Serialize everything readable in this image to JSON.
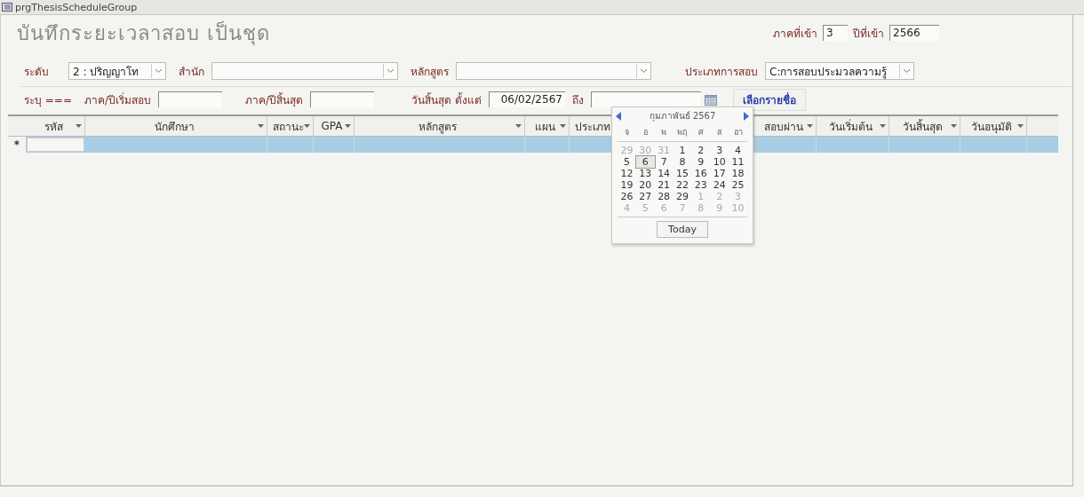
{
  "window": {
    "title": "prgThesisScheduleGroup"
  },
  "form_title": "บันทึกระยะเวลาสอบ เป็นชุด",
  "entry": {
    "term_label": "ภาคที่เข้า",
    "term": "3",
    "year_label": "ปีที่เข้า",
    "year": "2566"
  },
  "filters": [
    {
      "label": "ระดับ",
      "value": "2 : ปริญญาโท"
    },
    {
      "label": "สำนัก"
    },
    {
      "label": "หลักสูตร"
    },
    {
      "label": "ประเภทการสอบ",
      "value": "C:การสอบประมวลความรู้"
    }
  ],
  "range": {
    "prefix": "ระบุ ===",
    "start_label": "ภาค/ปีเริ่มสอบ",
    "end_label": "ภาค/ปีสิ้นสุด",
    "from_label": "วันสิ้นสุด ตั้งแต่",
    "from": "06/02/2567",
    "to_label": "ถึง",
    "button": "เลือกรายชื่อ"
  },
  "table": {
    "columns": [
      "รหัส",
      "นักศึกษา",
      "สถานะ",
      "GPA",
      "หลักสูตร",
      "แผน",
      "ประเภท",
      "",
      "สอบผ่าน",
      "วันเริ่มต้น",
      "วันสิ้นสุด",
      "วันอนุมัติ"
    ],
    "new_row_marker": "*"
  },
  "calendar": {
    "month": "กุมภาพันธ์ 2567",
    "weekdays": [
      "จ",
      "อ",
      "พ",
      "พฤ",
      "ศ",
      "ส",
      "อา"
    ],
    "today_button": "Today",
    "days": [
      {
        "day": "29",
        "in_month": false,
        "selected": false
      },
      {
        "day": "30",
        "in_month": false,
        "selected": false
      },
      {
        "day": "31",
        "in_month": false,
        "selected": false
      },
      {
        "day": "1",
        "in_month": true,
        "selected": false
      },
      {
        "day": "2",
        "in_month": true,
        "selected": false
      },
      {
        "day": "3",
        "in_month": true,
        "selected": false
      },
      {
        "day": "4",
        "in_month": true,
        "selected": false
      },
      {
        "day": "5",
        "in_month": true,
        "selected": false
      },
      {
        "day": "6",
        "in_month": true,
        "selected": true
      },
      {
        "day": "7",
        "in_month": true,
        "selected": false
      },
      {
        "day": "8",
        "in_month": true,
        "selected": false
      },
      {
        "day": "9",
        "in_month": true,
        "selected": false
      },
      {
        "day": "10",
        "in_month": true,
        "selected": false
      },
      {
        "day": "11",
        "in_month": true,
        "selected": false
      },
      {
        "day": "12",
        "in_month": true,
        "selected": false
      },
      {
        "day": "13",
        "in_month": true,
        "selected": false
      },
      {
        "day": "14",
        "in_month": true,
        "selected": false
      },
      {
        "day": "15",
        "in_month": true,
        "selected": false
      },
      {
        "day": "16",
        "in_month": true,
        "selected": false
      },
      {
        "day": "17",
        "in_month": true,
        "selected": false
      },
      {
        "day": "18",
        "in_month": true,
        "selected": false
      },
      {
        "day": "19",
        "in_month": true,
        "selected": false
      },
      {
        "day": "20",
        "in_month": true,
        "selected": false
      },
      {
        "day": "21",
        "in_month": true,
        "selected": false
      },
      {
        "day": "22",
        "in_month": true,
        "selected": false
      },
      {
        "day": "23",
        "in_month": true,
        "selected": false
      },
      {
        "day": "24",
        "in_month": true,
        "selected": false
      },
      {
        "day": "25",
        "in_month": true,
        "selected": false
      },
      {
        "day": "26",
        "in_month": true,
        "selected": false
      },
      {
        "day": "27",
        "in_month": true,
        "selected": false
      },
      {
        "day": "28",
        "in_month": true,
        "selected": false
      },
      {
        "day": "29",
        "in_month": true,
        "selected": false
      },
      {
        "day": "1",
        "in_month": false,
        "selected": false
      },
      {
        "day": "2",
        "in_month": false,
        "selected": false
      },
      {
        "day": "3",
        "in_month": false,
        "selected": false
      },
      {
        "day": "4",
        "in_month": false,
        "selected": false
      },
      {
        "day": "5",
        "in_month": false,
        "selected": false
      },
      {
        "day": "6",
        "in_month": false,
        "selected": false
      },
      {
        "day": "7",
        "in_month": false,
        "selected": false
      },
      {
        "day": "8",
        "in_month": false,
        "selected": false
      },
      {
        "day": "9",
        "in_month": false,
        "selected": false
      },
      {
        "day": "10",
        "in_month": false,
        "selected": false
      }
    ]
  }
}
